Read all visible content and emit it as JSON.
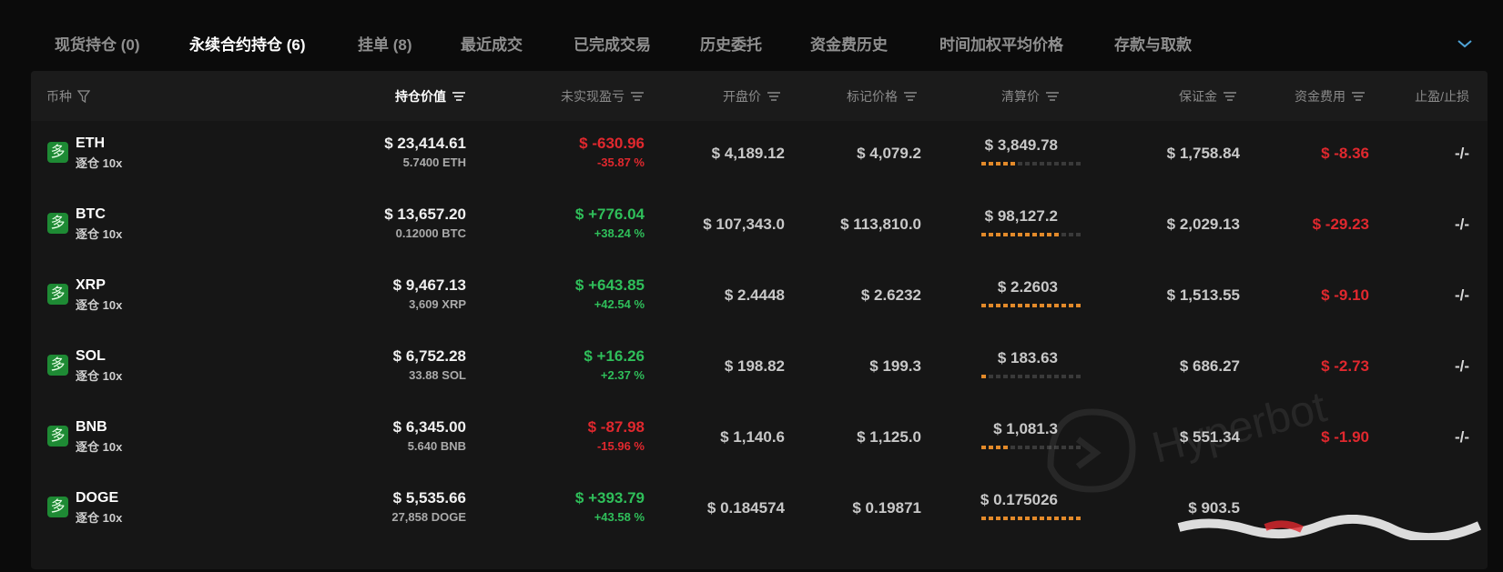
{
  "tabs": [
    {
      "label": "现货持仓 (0)"
    },
    {
      "label": "永续合约持仓 (6)"
    },
    {
      "label": "挂单 (8)"
    },
    {
      "label": "最近成交"
    },
    {
      "label": "已完成交易"
    },
    {
      "label": "历史委托"
    },
    {
      "label": "资金费历史"
    },
    {
      "label": "时间加权平均价格"
    },
    {
      "label": "存款与取款"
    }
  ],
  "columns": {
    "coin": "币种",
    "position_value": "持仓价值",
    "unrealized_pnl": "未实现盈亏",
    "entry_price": "开盘价",
    "mark_price": "标记价格",
    "liq_price": "清算价",
    "margin": "保证金",
    "funding": "资金费用",
    "tp_sl": "止盈/止损"
  },
  "rows": [
    {
      "side": "多",
      "symbol": "ETH",
      "mode": "逐仓 10x",
      "value": "$ 23,414.61",
      "size": "5.7400 ETH",
      "pnl": "$ -630.96",
      "pnl_pct": "-35.87 %",
      "pnl_sign": "neg",
      "entry": "$ 4,189.12",
      "mark": "$ 4,079.2",
      "liq": "$ 3,849.78",
      "liq_risk": 0.39,
      "margin": "$ 1,758.84",
      "funding": "$ -8.36",
      "tpsl": "-/-"
    },
    {
      "side": "多",
      "symbol": "BTC",
      "mode": "逐仓 10x",
      "value": "$ 13,657.20",
      "size": "0.12000 BTC",
      "pnl": "$ +776.04",
      "pnl_pct": "+38.24 %",
      "pnl_sign": "pos",
      "entry": "$ 107,343.0",
      "mark": "$ 113,810.0",
      "liq": "$ 98,127.2",
      "liq_risk": 0.78,
      "margin": "$ 2,029.13",
      "funding": "$ -29.23",
      "tpsl": "-/-"
    },
    {
      "side": "多",
      "symbol": "XRP",
      "mode": "逐仓 10x",
      "value": "$ 9,467.13",
      "size": "3,609 XRP",
      "pnl": "$ +643.85",
      "pnl_pct": "+42.54 %",
      "pnl_sign": "pos",
      "entry": "$ 2.4448",
      "mark": "$ 2.6232",
      "liq": "$ 2.2603",
      "liq_risk": 1.0,
      "margin": "$ 1,513.55",
      "funding": "$ -9.10",
      "tpsl": "-/-"
    },
    {
      "side": "多",
      "symbol": "SOL",
      "mode": "逐仓 10x",
      "value": "$ 6,752.28",
      "size": "33.88 SOL",
      "pnl": "$ +16.26",
      "pnl_pct": "+2.37 %",
      "pnl_sign": "pos",
      "entry": "$ 198.82",
      "mark": "$ 199.3",
      "liq": "$ 183.63",
      "liq_risk": 0.1,
      "margin": "$ 686.27",
      "funding": "$ -2.73",
      "tpsl": "-/-"
    },
    {
      "side": "多",
      "symbol": "BNB",
      "mode": "逐仓 10x",
      "value": "$ 6,345.00",
      "size": "5.640 BNB",
      "pnl": "$ -87.98",
      "pnl_pct": "-15.96 %",
      "pnl_sign": "neg",
      "entry": "$ 1,140.6",
      "mark": "$ 1,125.0",
      "liq": "$ 1,081.3",
      "liq_risk": 0.29,
      "margin": "$ 551.34",
      "funding": "$ -1.90",
      "tpsl": "-/-"
    },
    {
      "side": "多",
      "symbol": "DOGE",
      "mode": "逐仓 10x",
      "value": "$ 5,535.66",
      "size": "27,858 DOGE",
      "pnl": "$ +393.79",
      "pnl_pct": "+43.58 %",
      "pnl_sign": "pos",
      "entry": "$ 0.184574",
      "mark": "$ 0.19871",
      "liq": "$ 0.175026",
      "liq_risk": 1.0,
      "margin": "$ 903.5",
      "funding": "",
      "tpsl": ""
    }
  ],
  "watermark": "Hyperbot",
  "colors": {
    "positive": "#2fbf5a",
    "negative": "#e0282e",
    "long_badge": "#1e8a34",
    "risk_on": "#e38a2a"
  }
}
